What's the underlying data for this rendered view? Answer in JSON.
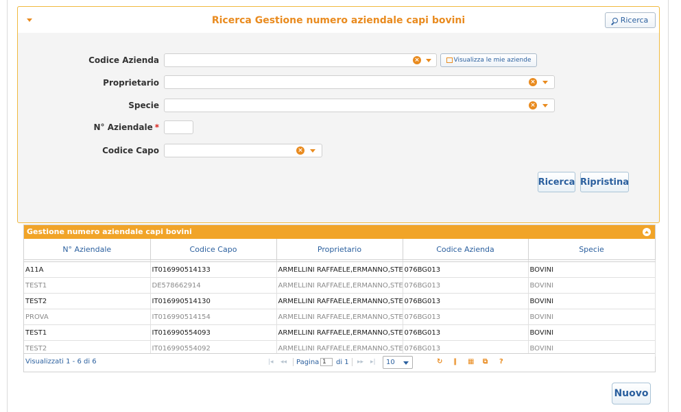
{
  "search_panel": {
    "title": "Ricerca Gestione numero aziendale capi bovini",
    "header_search_label": "Ricerca",
    "fields": {
      "codice_azienda": {
        "label": "Codice Azienda",
        "value": ""
      },
      "proprietario": {
        "label": "Proprietario",
        "value": ""
      },
      "specie": {
        "label": "Specie",
        "value": ""
      },
      "n_aziendale": {
        "label": "N° Aziendale",
        "required_mark": "*",
        "value": ""
      },
      "codice_capo": {
        "label": "Codice Capo",
        "value": ""
      }
    },
    "mie_aziende_label": "Visualizza le mie aziende",
    "search_button": "Ricerca",
    "reset_button": "Ripristina"
  },
  "grid": {
    "caption": "Gestione numero aziendale capi bovini",
    "columns": [
      "N° Aziendale",
      "Codice Capo",
      "Proprietario",
      "Codice Azienda",
      "Specie"
    ],
    "rows": [
      [
        "A11A",
        "IT016990514133",
        "ARMELLINI RAFFAELE,ERMANNO,STEFANO",
        "076BG013",
        "BOVINI"
      ],
      [
        "TEST1",
        "DE578662914",
        "ARMELLINI RAFFAELE,ERMANNO,STEFANO",
        "076BG013",
        "BOVINI"
      ],
      [
        "TEST2",
        "IT016990514130",
        "ARMELLINI RAFFAELE,ERMANNO,STEFANO",
        "076BG013",
        "BOVINI"
      ],
      [
        "PROVA",
        "IT016990514154",
        "ARMELLINI RAFFAELE,ERMANNO,STEFANO",
        "076BG013",
        "BOVINI"
      ],
      [
        "TEST1",
        "IT016990554093",
        "ARMELLINI RAFFAELE,ERMANNO,STEFANO",
        "076BG013",
        "BOVINI"
      ],
      [
        "TEST2",
        "IT016990554092",
        "ARMELLINI RAFFAELE,ERMANNO,STEFANO",
        "076BG013",
        "BOVINI"
      ]
    ],
    "pager": {
      "info": "Visualizzati 1 - 6 di 6",
      "page_label": "Pagina",
      "current_page": "1",
      "of_label": "di 1",
      "page_size": "10",
      "help": "?"
    }
  },
  "new_button": "Nuovo",
  "colors": {
    "accent": "#e98b1f",
    "caption": "#f1a428",
    "link": "#2a5f9e"
  }
}
